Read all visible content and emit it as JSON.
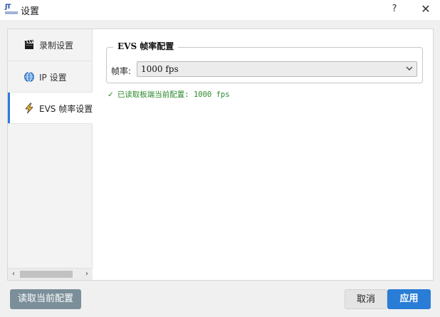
{
  "window": {
    "title": "设置",
    "help_label": "?",
    "close_label": "✕",
    "app_icon": "jt-logo-icon"
  },
  "sidebar": {
    "items": [
      {
        "label": "录制设置",
        "icon": "clapperboard-icon",
        "active": false
      },
      {
        "label": "IP 设置",
        "icon": "globe-icon",
        "active": false
      },
      {
        "label": "EVS 帧率设置",
        "icon": "lightning-icon",
        "active": true
      }
    ],
    "scroll_left": "‹",
    "scroll_right": "›"
  },
  "evs_group": {
    "title": "EVS 帧率配置",
    "fps_label": "帧率:",
    "fps_value": "1000 fps",
    "status_check": "✓",
    "status_text": "已读取板端当前配置: 1000 fps"
  },
  "buttons": {
    "read_current": "读取当前配置",
    "cancel": "取消",
    "apply": "应用"
  },
  "colors": {
    "accent": "#2a7dd6",
    "success": "#2c8a2c",
    "read_button": "#7b8f9a"
  }
}
